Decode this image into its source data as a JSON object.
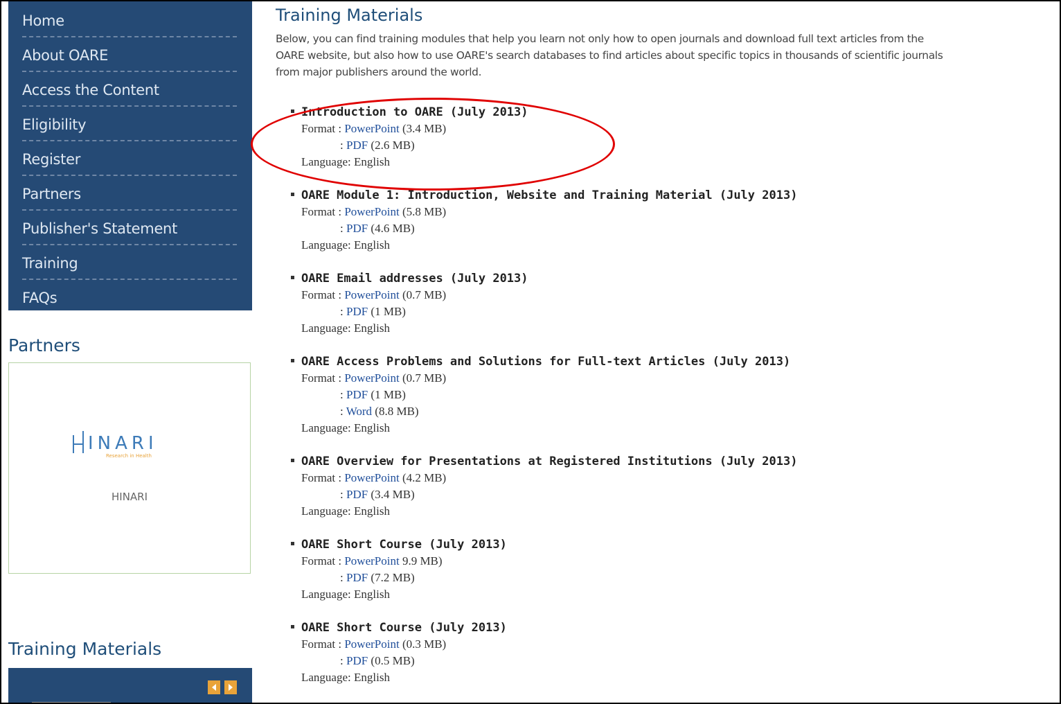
{
  "sidebar": {
    "nav": [
      "Home",
      "About OARE",
      "Access the Content",
      "Eligibility",
      "Register",
      "Partners",
      "Publisher's Statement",
      "Training",
      "FAQs"
    ],
    "partners_heading": "Partners",
    "partner": {
      "logo_text": "INARI",
      "logo_tagline": "Research in Health",
      "caption": "HINARI"
    },
    "training_heading": "Training Materials"
  },
  "main": {
    "title": "Training Materials",
    "intro_lines": [
      "Below, you can find training modules that help you learn not only how to open journals and download full text articles from the",
      "OARE website, but also how to use OARE's search databases to find articles about specific topics in thousands of scientific journals",
      "from major publishers around the world."
    ],
    "format_prefix": "Format :",
    "alt_prefix": ":",
    "modules": [
      {
        "title": "Introduction to OARE (July 2013)",
        "formats": [
          {
            "link": "PowerPoint",
            "size": "(3.4 MB)"
          },
          {
            "link": "PDF",
            "size": "(2.6 MB)"
          }
        ],
        "language": "Language: English"
      },
      {
        "title": "OARE Module 1: Introduction, Website and Training Material (July 2013)",
        "formats": [
          {
            "link": "PowerPoint",
            "size": "(5.8 MB)"
          },
          {
            "link": "PDF",
            "size": "(4.6 MB)"
          }
        ],
        "language": "Language: English"
      },
      {
        "title": "OARE Email addresses (July 2013)",
        "formats": [
          {
            "link": "PowerPoint",
            "size": "(0.7 MB)"
          },
          {
            "link": "PDF",
            "size": "(1 MB)"
          }
        ],
        "language": "Language: English"
      },
      {
        "title": "OARE Access Problems and Solutions for Full-text Articles (July 2013)",
        "formats": [
          {
            "link": "PowerPoint",
            "size": "(0.7 MB)"
          },
          {
            "link": "PDF",
            "size": "(1 MB)"
          },
          {
            "link": "Word",
            "size": "(8.8 MB)"
          }
        ],
        "language": "Language: English"
      },
      {
        "title": "OARE Overview for Presentations at Registered Institutions (July 2013)",
        "formats": [
          {
            "link": "PowerPoint",
            "size": "(4.2 MB)"
          },
          {
            "link": "PDF",
            "size": "(3.4 MB)"
          }
        ],
        "language": "Language: English"
      },
      {
        "title": "OARE Short Course (July 2013)",
        "formats": [
          {
            "link": "PowerPoint",
            "size": "9.9 MB)"
          },
          {
            "link": "PDF",
            "size": "(7.2 MB)"
          }
        ],
        "language": "Language: English"
      },
      {
        "title": "OARE Short Course (July 2013)",
        "formats": [
          {
            "link": "PowerPoint",
            "size": "(0.3 MB)"
          },
          {
            "link": "PDF",
            "size": "(0.5 MB)"
          }
        ],
        "language": "Language: English"
      }
    ]
  },
  "colors": {
    "nav_bg": "#254a75",
    "heading": "#1f4e79",
    "link": "#1f4e9a",
    "highlight": "#e00000"
  }
}
